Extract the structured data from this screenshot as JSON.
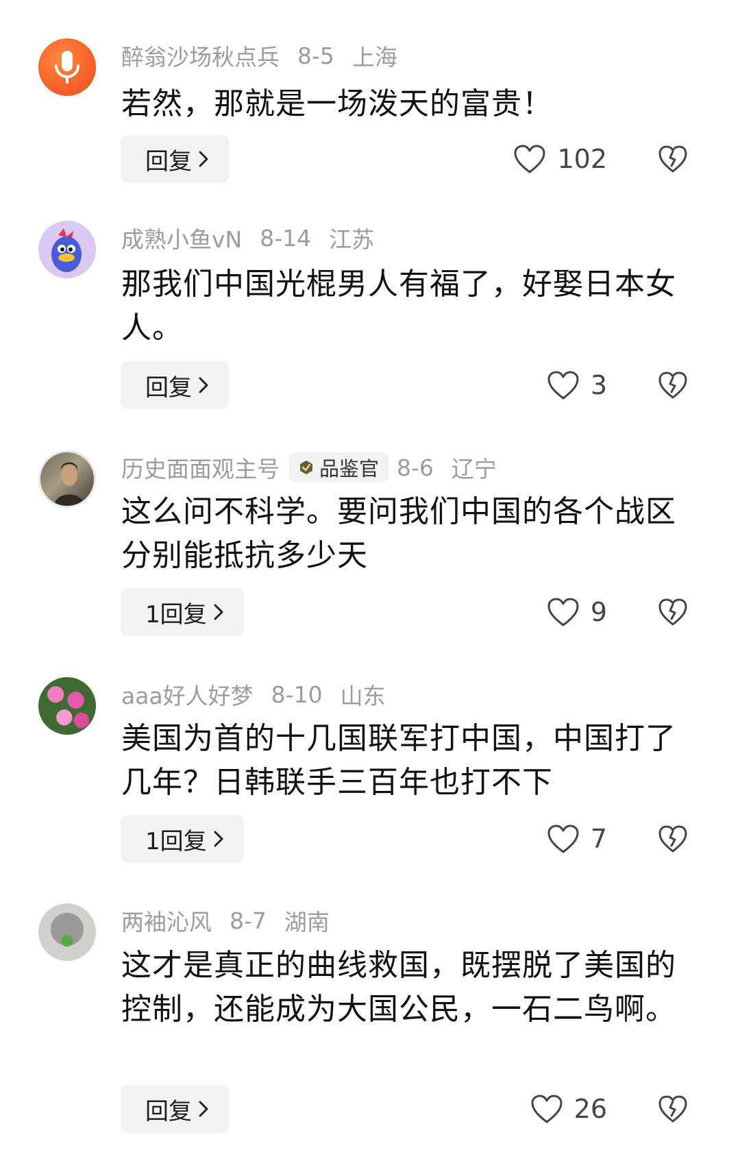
{
  "comments": [
    {
      "username": "醉翁沙场秋点兵",
      "date": "8-5",
      "location": "上海",
      "badge": null,
      "text": "若然，那就是一场泼天的富贵！",
      "reply_label": "回复",
      "likes": "102",
      "avatar_icon": "microphone-icon"
    },
    {
      "username": "成熟小鱼vN",
      "date": "8-14",
      "location": "江苏",
      "badge": null,
      "text": "那我们中国光棍男人有福了，好娶日本女人。",
      "reply_label": "回复",
      "likes": "3",
      "avatar_icon": "cartoon-bird-avatar"
    },
    {
      "username": "历史面面观主号",
      "date": "8-6",
      "location": "辽宁",
      "badge": "品鉴官",
      "text": "这么问不科学。要问我们中国的各个战区分别能抵抗多少天",
      "reply_label": "1回复",
      "likes": "9",
      "avatar_icon": "photo-avatar"
    },
    {
      "username": "aaa好人好梦",
      "date": "8-10",
      "location": "山东",
      "badge": null,
      "text": "美国为首的十几国联军打中国，中国打了几年？日韩联手三百年也打不下",
      "reply_label": "1回复",
      "likes": "7",
      "avatar_icon": "flower-avatar"
    },
    {
      "username": "两袖沁风",
      "date": "8-7",
      "location": "湖南",
      "badge": null,
      "text": "这才是真正的曲线救国，既摆脱了美国的控制，还能成为大国公民，一石二鸟啊。",
      "reply_label": "回复",
      "likes": "26",
      "avatar_icon": "koala-avatar"
    }
  ],
  "colors": {
    "meta_gray": "#9c9c9c",
    "button_bg": "#f2f2f2",
    "text": "#111111",
    "avatar_orange": "#f0471a"
  }
}
